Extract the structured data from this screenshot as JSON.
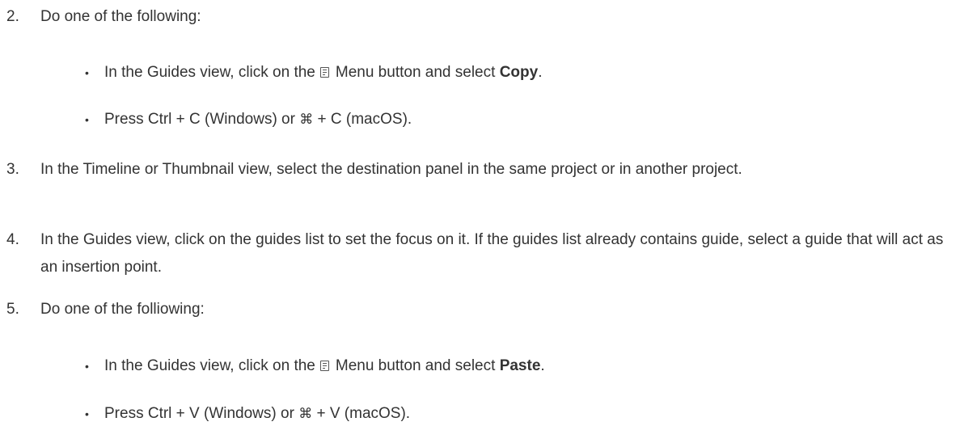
{
  "steps": [
    {
      "number": "2.",
      "text": "Do one of the following:",
      "bullets": [
        {
          "before_icon": "In the Guides view, click on the",
          "icon": "menu-icon",
          "after_icon": "Menu button and select",
          "bold": "Copy",
          "end": "."
        },
        {
          "text_a": "Press Ctrl + C (Windows) or",
          "glyph": "⌘",
          "text_b": "+ C (macOS)."
        }
      ]
    },
    {
      "number": "3.",
      "text": "In the Timeline or Thumbnail view, select the destination panel in the same project or in another project."
    },
    {
      "number": "4.",
      "text": "In the Guides view, click on the guides list to set the focus on it. If the guides list already contains guide, select a guide that will act as an insertion point."
    },
    {
      "number": "5.",
      "text": "Do one of the folliowing:",
      "bullets": [
        {
          "before_icon": "In the Guides view, click on the",
          "icon": "menu-icon",
          "after_icon": "Menu button and select",
          "bold": "Paste",
          "end": "."
        },
        {
          "text_a": "Press Ctrl + V (Windows) or",
          "glyph": "⌘",
          "text_b": "+ V (macOS)."
        }
      ]
    }
  ],
  "bullet_glyph": "•"
}
